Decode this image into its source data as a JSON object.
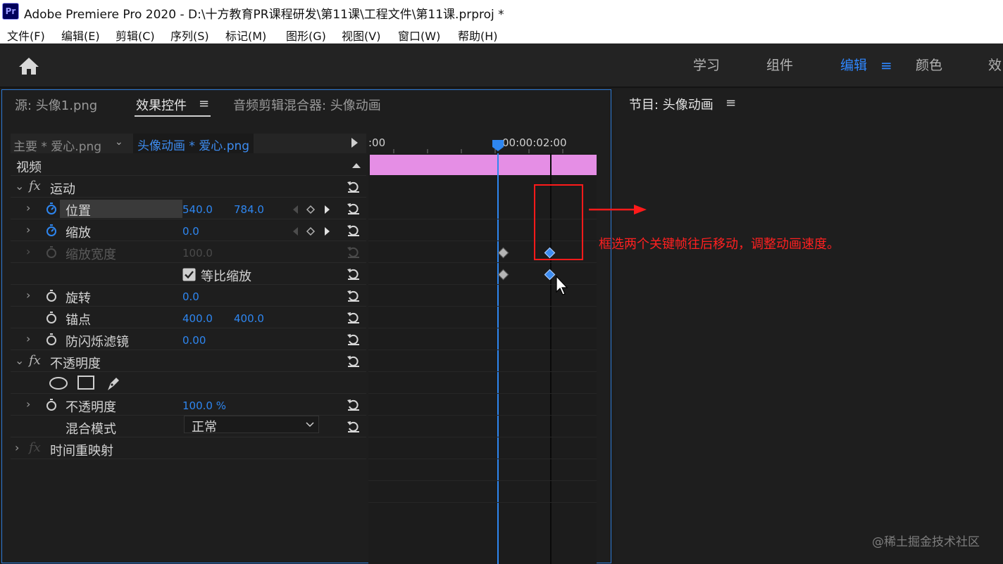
{
  "app": {
    "logo_text": "Pr",
    "title": "Adobe Premiere Pro 2020 - D:\\十方教育PR课程研发\\第11课\\工程文件\\第11课.prproj *"
  },
  "menu": [
    "文件(F)",
    "编辑(E)",
    "剪辑(C)",
    "序列(S)",
    "标记(M)",
    "图形(G)",
    "视图(V)",
    "窗口(W)",
    "帮助(H)"
  ],
  "workspaces": {
    "items": [
      "学习",
      "组件",
      "编辑",
      "颜色",
      "效"
    ],
    "active": "编辑"
  },
  "effect_panel": {
    "tabs": [
      "源: 头像1.png",
      "效果控件",
      "音频剪辑混合器: 头像动画"
    ],
    "active_tab": "效果控件",
    "master_label": "主要 * 爱心.png",
    "sequence_label": "头像动画 * 爱心.png",
    "video_header": "视频",
    "motion": "运动",
    "opacity_group": "不透明度",
    "time_remap": "时间重映射",
    "properties": {
      "position": {
        "label": "位置",
        "x": "540.0",
        "y": "784.0"
      },
      "scale": {
        "label": "缩放",
        "value": "0.0"
      },
      "scale_width": {
        "label": "缩放宽度",
        "value": "100.0"
      },
      "uniform_scale": {
        "label": "等比缩放",
        "checked": true
      },
      "rotation": {
        "label": "旋转",
        "value": "0.0"
      },
      "anchor": {
        "label": "锚点",
        "x": "400.0",
        "y": "400.0"
      },
      "flicker": {
        "label": "防闪烁滤镜",
        "value": "0.00"
      },
      "opacity": {
        "label": "不透明度",
        "value": "100.0 %"
      },
      "blend_mode": {
        "label": "混合模式",
        "value": "正常"
      }
    }
  },
  "timeline": {
    "start_label": ":00",
    "playhead_label": "00:00:02:00",
    "clip_color": "#e58ee5"
  },
  "program_panel": {
    "title": "节目: 头像动画"
  },
  "annotation": {
    "text": "框选两个关键帧往后移动，调整动画速度。",
    "color": "#ff2020"
  },
  "watermark": "@稀土掘金技术社区",
  "colors": {
    "accent": "#2f87ff",
    "value_blue": "#2e86f0"
  }
}
